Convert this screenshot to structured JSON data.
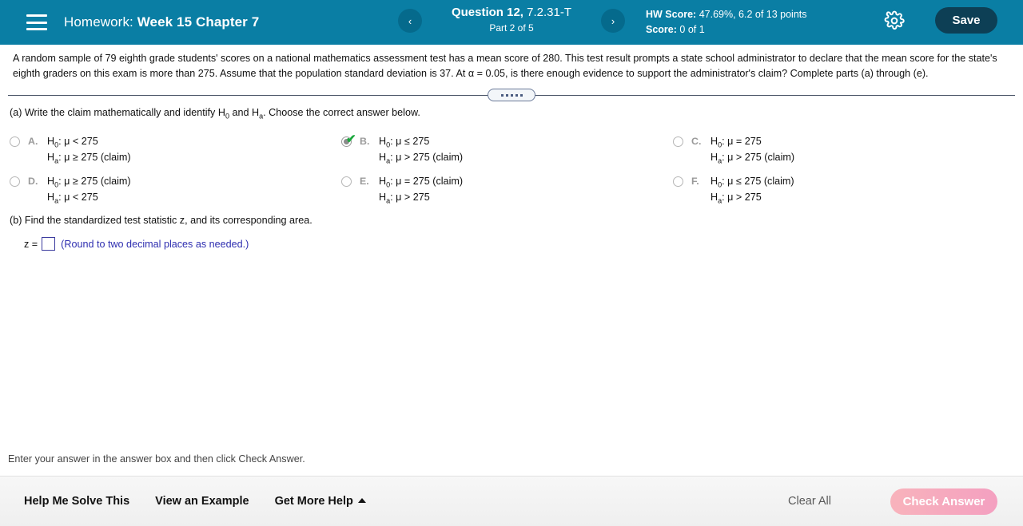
{
  "header": {
    "menu_icon": "hamburger-icon",
    "homework_label": "Homework:",
    "homework_name": "Week 15 Chapter 7",
    "prev_icon": "chevron-left-icon",
    "next_icon": "chevron-right-icon",
    "question_label": "Question 12,",
    "question_id": "7.2.31-T",
    "part_text": "Part 2 of 5",
    "hw_score_label": "HW Score:",
    "hw_score_value": "47.69%, 6.2 of 13 points",
    "score_label": "Score:",
    "score_value": "0 of 1",
    "settings_icon": "gear-icon",
    "save_label": "Save",
    "bg_color": "#0a7ea4",
    "save_bg_color": "#0d3f55"
  },
  "problem": {
    "statement": "A random sample of 79 eighth grade students' scores on a national mathematics assessment test has a mean score of 280. This test result prompts a state school administrator to declare that the mean score for the state's eighth graders on this exam is more than 275. Assume that the population standard deviation is 37. At α = 0.05, is there enough evidence to support the administrator's claim? Complete parts (a) through (e).",
    "drag_handle": "resize-handle"
  },
  "part_a": {
    "prompt_1": "(a) Write the claim mathematically and identify H",
    "prompt_sub_1": "0",
    "prompt_2": " and H",
    "prompt_sub_2": "a",
    "prompt_3": ". Choose the correct answer below.",
    "choices": [
      {
        "letter": "A.",
        "null_prefix": "H",
        "null_sub": "0",
        "null_text": ": μ < 275",
        "alt_prefix": "H",
        "alt_sub": "a",
        "alt_text": ": μ ≥ 275 (claim)",
        "selected": false,
        "correct": false
      },
      {
        "letter": "B.",
        "null_prefix": "H",
        "null_sub": "0",
        "null_text": ": μ ≤ 275",
        "alt_prefix": "H",
        "alt_sub": "a",
        "alt_text": ": μ > 275 (claim)",
        "selected": true,
        "correct": true
      },
      {
        "letter": "C.",
        "null_prefix": "H",
        "null_sub": "0",
        "null_text": ": μ = 275",
        "alt_prefix": "H",
        "alt_sub": "a",
        "alt_text": ": μ > 275 (claim)",
        "selected": false,
        "correct": false
      },
      {
        "letter": "D.",
        "null_prefix": "H",
        "null_sub": "0",
        "null_text": ": μ ≥ 275 (claim)",
        "alt_prefix": "H",
        "alt_sub": "a",
        "alt_text": ": μ < 275",
        "selected": false,
        "correct": false
      },
      {
        "letter": "E.",
        "null_prefix": "H",
        "null_sub": "0",
        "null_text": ": μ = 275 (claim)",
        "alt_prefix": "H",
        "alt_sub": "a",
        "alt_text": ": μ > 275",
        "selected": false,
        "correct": false
      },
      {
        "letter": "F.",
        "null_prefix": "H",
        "null_sub": "0",
        "null_text": ": μ ≤ 275 (claim)",
        "alt_prefix": "H",
        "alt_sub": "a",
        "alt_text": ": μ > 275",
        "selected": false,
        "correct": false
      }
    ],
    "correct_mark": "green-check-icon",
    "correct_color": "#1aa73c"
  },
  "part_b": {
    "prompt": "(b) Find the standardized test statistic z, and its corresponding area.",
    "z_label": "z =",
    "z_value": "",
    "z_placeholder": "",
    "hint": "(Round to two decimal places as needed.)",
    "hint_color": "#2e2eb0"
  },
  "footer": {
    "note": "Enter your answer in the answer box and then click Check Answer.",
    "help_me_solve": "Help Me Solve This",
    "view_example": "View an Example",
    "get_more_help": "Get More Help",
    "get_more_help_icon": "caret-up-icon",
    "clear_all": "Clear All",
    "check_answer": "Check Answer",
    "check_answer_color": "#f4a0c0"
  }
}
